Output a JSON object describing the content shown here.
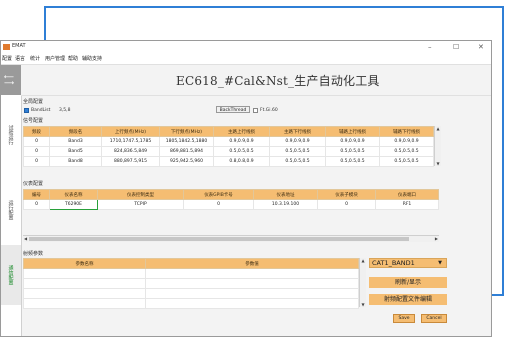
{
  "window": {
    "title": "EMAT",
    "controls": {
      "minimize": "–",
      "maximize": "☐",
      "close": "✕"
    }
  },
  "menu": [
    "配置",
    "语言",
    "统计",
    "用户管理",
    "帮助",
    "辅助支持"
  ],
  "sidebar": {
    "items": [
      {
        "label": "试验运行"
      },
      {
        "label": "运行配置"
      },
      {
        "label": "通信配置",
        "active": true
      }
    ]
  },
  "heading": "EC618_#Cal&Nst_生产自动化工具",
  "global_config": {
    "label": "全局配置",
    "bandlist_label": "BandList",
    "bandlist_checked": true,
    "bandlist_value": "3,5,8",
    "button_label": "BackThread",
    "fw_checked": false,
    "fw_label": "Ft.Gi.60"
  },
  "signal_config": {
    "label": "信号配置",
    "columns": [
      "频段",
      "频段名",
      "上行频点(MHz)",
      "下行频点(MHz)",
      "主路上行线损",
      "主路下行线损",
      "辅路上行线损",
      "辅路下行线损"
    ],
    "rows": [
      [
        "0",
        "Band3",
        "1710,1747.5,1785",
        "1805,1842.5,1880",
        "0.9,0.9,0.9",
        "0.9,0.9,0.9",
        "0.9,0.9,0.9",
        "0.9,0.9,0.9"
      ],
      [
        "0",
        "Band5",
        "824,836.5,849",
        "869,881.5,894",
        "0.5,0.5,0.5",
        "0.5,0.5,0.5",
        "0.5,0.5,0.5",
        "0.5,0.5,0.5"
      ],
      [
        "0",
        "Band8",
        "880,897.5,915",
        "925,942.5,960",
        "0.8,0.8,0.9",
        "0.5,0.5,0.5",
        "0.5,0.5,0.5",
        "0.5,0.5,0.5"
      ]
    ]
  },
  "instrument_config": {
    "label": "仪表配置",
    "columns": [
      "编号",
      "仪表名称",
      "仪表控制类型",
      "仪表GPIB卡号",
      "仪表地址",
      "仪表子模块",
      "仪表端口"
    ],
    "rows": [
      [
        "0",
        "T6290E",
        "TCPIP",
        "0",
        "10.3.19.100",
        "0",
        "RF1"
      ]
    ]
  },
  "param_config": {
    "label": "射频参数",
    "columns": [
      "参数名称",
      "参数值"
    ],
    "select_value": "CAT1_BAND1",
    "refresh_button": "刷新/显示",
    "edit_button": "射频配置文件编辑"
  },
  "footer": {
    "save_button": "Save",
    "cancel_button": "Cancel"
  },
  "colors": {
    "accent": "#f5bd72",
    "frame": "#2f7fd6",
    "highlight_box": "#28a03a"
  }
}
